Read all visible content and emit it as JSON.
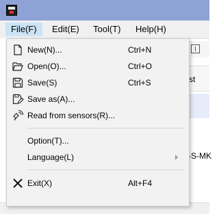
{
  "menubar": {
    "items": [
      {
        "label": "File(F)"
      },
      {
        "label": "Edit(E)"
      },
      {
        "label": "Tool(T)"
      },
      {
        "label": "Help(H)"
      }
    ]
  },
  "background": {
    "list_header_fragment": "st",
    "row_fragment": "-S-MK"
  },
  "file_menu": {
    "items": [
      {
        "label": "New(N)...",
        "shortcut": "Ctrl+N",
        "icon": "new-file-icon"
      },
      {
        "label": "Open(O)...",
        "shortcut": "Ctrl+O",
        "icon": "open-folder-icon"
      },
      {
        "label": "Save(S)",
        "shortcut": "Ctrl+S",
        "icon": "save-icon"
      },
      {
        "label": "Save as(A)...",
        "shortcut": "",
        "icon": "save-as-icon"
      },
      {
        "label": "Read from sensors(R)...",
        "shortcut": "",
        "icon": "read-sensors-icon"
      },
      {
        "label": "Option(T)...",
        "shortcut": ""
      },
      {
        "label": "Language(L)",
        "shortcut": "",
        "submenu": true
      },
      {
        "label": "Exit(X)",
        "shortcut": "Alt+F4",
        "icon": "close-icon"
      }
    ]
  },
  "colors": {
    "titlebar": "#8ea2d6",
    "menu_active": "#cce4f7",
    "menu_background": "#f2f2f2"
  }
}
